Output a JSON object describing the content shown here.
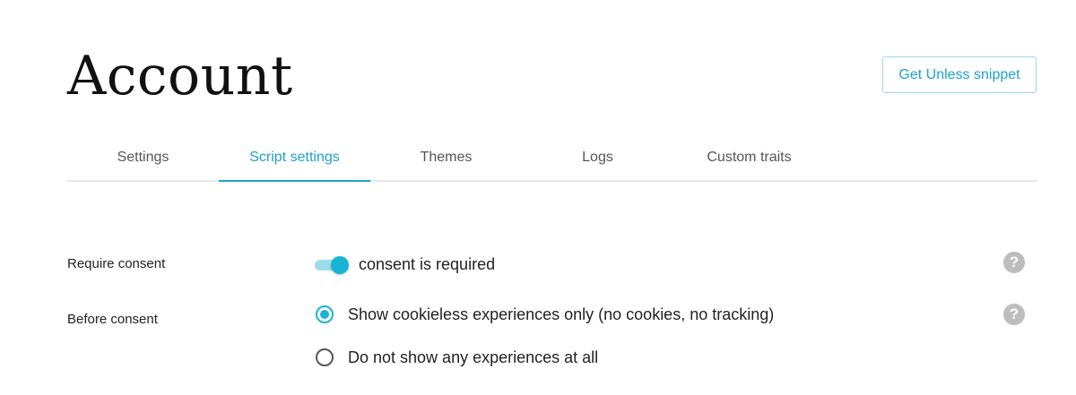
{
  "header": {
    "title": "Account",
    "snippet_button": "Get Unless snippet"
  },
  "tabs": [
    {
      "label": "Settings",
      "active": false
    },
    {
      "label": "Script settings",
      "active": true
    },
    {
      "label": "Themes",
      "active": false
    },
    {
      "label": "Logs",
      "active": false
    },
    {
      "label": "Custom traits",
      "active": false
    }
  ],
  "consent": {
    "label": "Require consent",
    "toggle_on": true,
    "toggle_text": "consent is required",
    "help_icon": "?"
  },
  "before_consent": {
    "label": "Before consent",
    "selected_index": 0,
    "options": [
      "Show cookieless experiences only (no cookies, no tracking)",
      "Do not show any experiences at all"
    ],
    "help_icon": "?"
  },
  "colors": {
    "accent": "#1e9fd6",
    "toggle": "#17b4d6",
    "help": "#bdbdbd"
  }
}
